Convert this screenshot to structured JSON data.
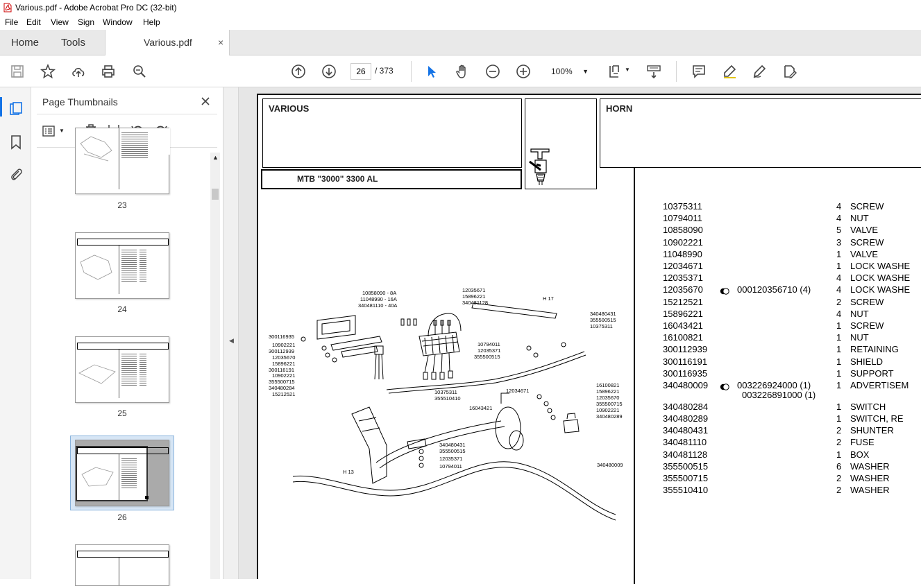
{
  "window": {
    "title": "Various.pdf - Adobe Acrobat Pro DC (32-bit)"
  },
  "menu": [
    "File",
    "Edit",
    "View",
    "Sign",
    "Window",
    "Help"
  ],
  "tabs": {
    "home": "Home",
    "tools": "Tools",
    "document": "Various.pdf",
    "close": "×"
  },
  "toolbar": {
    "current_page": "26",
    "total_pages": "/ 373",
    "zoom": "100%"
  },
  "thumbnails": {
    "title": "Page Thumbnails",
    "pages": [
      {
        "label": "23"
      },
      {
        "label": "24"
      },
      {
        "label": "25"
      },
      {
        "label": "26",
        "selected": true
      }
    ]
  },
  "document": {
    "header_left": "VARIOUS",
    "header_right": "HORN",
    "model": "MTB \"3000\" 3300 AL",
    "parts": [
      {
        "num": "10375311",
        "ref": "",
        "qty": "4",
        "desc": "SCREW"
      },
      {
        "num": "10794011",
        "ref": "",
        "qty": "4",
        "desc": "NUT"
      },
      {
        "num": "10858090",
        "ref": "",
        "qty": "5",
        "desc": "VALVE"
      },
      {
        "num": "10902221",
        "ref": "",
        "qty": "3",
        "desc": "SCREW"
      },
      {
        "num": "11048990",
        "ref": "",
        "qty": "1",
        "desc": "VALVE"
      },
      {
        "num": "12034671",
        "ref": "",
        "qty": "1",
        "desc": "LOCK WASHE"
      },
      {
        "num": "12035371",
        "ref": "",
        "qty": "4",
        "desc": "LOCK WASHE"
      },
      {
        "num": "12035670",
        "ref": "000120356710  (4)",
        "qty": "4",
        "desc": "LOCK WASHE"
      },
      {
        "num": "15212521",
        "ref": "",
        "qty": "2",
        "desc": "SCREW"
      },
      {
        "num": "15896221",
        "ref": "",
        "qty": "4",
        "desc": "NUT"
      },
      {
        "num": "16043421",
        "ref": "",
        "qty": "1",
        "desc": "SCREW"
      },
      {
        "num": "16100821",
        "ref": "",
        "qty": "1",
        "desc": "NUT"
      },
      {
        "num": "300112939",
        "ref": "",
        "qty": "1",
        "desc": "RETAINING"
      },
      {
        "num": "300116191",
        "ref": "",
        "qty": "1",
        "desc": "SHIELD"
      },
      {
        "num": "300116935",
        "ref": "",
        "qty": "1",
        "desc": "SUPPORT"
      },
      {
        "num": "340480009",
        "ref": "003226924000  (1)",
        "ref2": "003226891000  (1)",
        "qty": "1",
        "desc": "ADVERTISEM"
      },
      {
        "num": "340480284",
        "ref": "",
        "qty": "1",
        "desc": "SWITCH"
      },
      {
        "num": "340480289",
        "ref": "",
        "qty": "1",
        "desc": "SWITCH, RE"
      },
      {
        "num": "340480431",
        "ref": "",
        "qty": "2",
        "desc": "SHUNTER"
      },
      {
        "num": "340481110",
        "ref": "",
        "qty": "2",
        "desc": "FUSE"
      },
      {
        "num": "340481128",
        "ref": "",
        "qty": "1",
        "desc": "BOX"
      },
      {
        "num": "355500515",
        "ref": "",
        "qty": "6",
        "desc": "WASHER"
      },
      {
        "num": "355500715",
        "ref": "",
        "qty": "2",
        "desc": "WASHER"
      },
      {
        "num": "355510410",
        "ref": "",
        "qty": "2",
        "desc": "WASHER"
      }
    ],
    "diagram_labels": {
      "l1": "10858090 - 8A",
      "l2": "11048990 - 16A",
      "l3": "340481110 - 40A",
      "l4": "12035671",
      "l5": "15896221",
      "l6": "340481128",
      "l7": "H 17",
      "l8": "340480431",
      "l9": "355500515",
      "l10": "10375311",
      "l11": "300116935",
      "l12": "10902221",
      "l13": "300112939",
      "l14": "12035670",
      "l15": "15896221",
      "l16": "300116191",
      "l17": "10902221",
      "l18": "355500715",
      "l19": "340480284",
      "l20": "15212521",
      "l21": "10794011",
      "l22": "12035371",
      "l23": "355500515",
      "l24": "10375311",
      "l25": "355510410",
      "l26": "12034671",
      "l27": "16100821",
      "l28": "15896221",
      "l29": "12035670",
      "l30": "355500715",
      "l31": "10902221",
      "l32": "340480289",
      "l33": "16043421",
      "l34": "340480431",
      "l35": "355500515",
      "l36": "12035371",
      "l37": "10794011",
      "l38": "H 13",
      "l39": "340480009"
    }
  }
}
